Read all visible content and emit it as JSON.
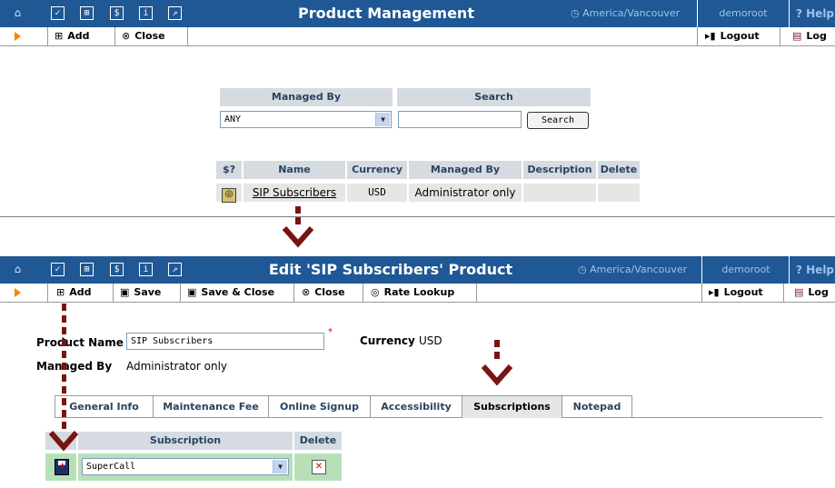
{
  "panel1": {
    "title": "Product Management",
    "timezone": "America/Vancouver",
    "user": "demoroot",
    "help": "Help",
    "toolbar": {
      "add": "Add",
      "close": "Close",
      "logout": "Logout",
      "log": "Log"
    },
    "filter": {
      "managed_by_header": "Managed By",
      "search_header": "Search",
      "managed_by_value": "ANY",
      "search_value": "",
      "search_button": "Search"
    },
    "table": {
      "headers": [
        "$?",
        "Name",
        "Currency",
        "Managed By",
        "Description",
        "Delete"
      ],
      "rows": [
        {
          "name": "SIP Subscribers",
          "currency": "USD",
          "managed_by": "Administrator only",
          "description": ""
        }
      ]
    }
  },
  "panel2": {
    "title": "Edit 'SIP Subscribers' Product",
    "timezone": "America/Vancouver",
    "user": "demoroot",
    "help": "Help",
    "toolbar": {
      "add": "Add",
      "save": "Save",
      "save_close": "Save & Close",
      "close": "Close",
      "rate_lookup": "Rate Lookup",
      "logout": "Logout",
      "log": "Log"
    },
    "form": {
      "product_name_label": "Product Name",
      "product_name_value": "SIP Subscribers",
      "required_mark": "*",
      "currency_label": "Currency",
      "currency_value": "USD",
      "managed_by_label": "Managed By",
      "managed_by_value": "Administrator only"
    },
    "tabs": [
      "General Info",
      "Maintenance Fee",
      "Online Signup",
      "Accessibility",
      "Subscriptions",
      "Notepad"
    ],
    "active_tab": "Subscriptions",
    "subscriptions": {
      "headers": [
        "Subscription",
        "Delete"
      ],
      "rows": [
        {
          "subscription": "SuperCall"
        }
      ]
    }
  },
  "colors": {
    "titlebar": "#1f5894",
    "header_cell": "#d6dbe2",
    "annotation_arrow": "#7a1414",
    "toolbar_arrow": "#f08a00"
  }
}
